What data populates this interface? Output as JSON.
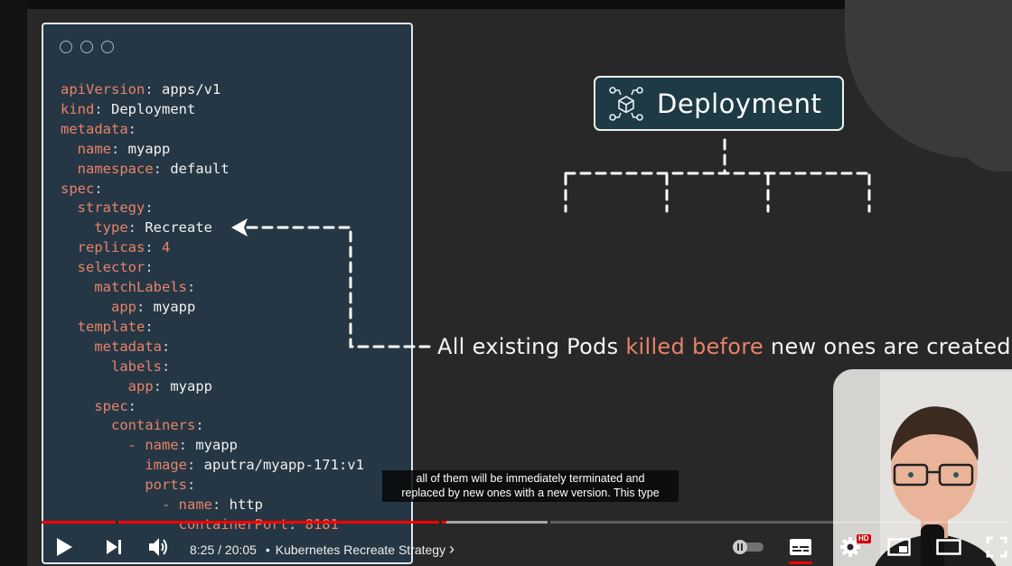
{
  "slide": {
    "code_lines": [
      [
        {
          "t": "apiVersion",
          "c": "k"
        },
        {
          "t": ": ",
          "c": "d"
        },
        {
          "t": "apps/v1",
          "c": "v"
        }
      ],
      [
        {
          "t": "kind",
          "c": "k"
        },
        {
          "t": ": ",
          "c": "d"
        },
        {
          "t": "Deployment",
          "c": "v"
        }
      ],
      [
        {
          "t": "metadata",
          "c": "k"
        },
        {
          "t": ":",
          "c": "d"
        }
      ],
      [
        {
          "t": "  name",
          "c": "k"
        },
        {
          "t": ": ",
          "c": "d"
        },
        {
          "t": "myapp",
          "c": "v"
        }
      ],
      [
        {
          "t": "  namespace",
          "c": "k"
        },
        {
          "t": ": ",
          "c": "d"
        },
        {
          "t": "default",
          "c": "v"
        }
      ],
      [
        {
          "t": "spec",
          "c": "k"
        },
        {
          "t": ":",
          "c": "d"
        }
      ],
      [
        {
          "t": "  strategy",
          "c": "k"
        },
        {
          "t": ":",
          "c": "d"
        }
      ],
      [
        {
          "t": "    type",
          "c": "k"
        },
        {
          "t": ": ",
          "c": "d"
        },
        {
          "t": "Recreate",
          "c": "v"
        }
      ],
      [
        {
          "t": "  replicas",
          "c": "k"
        },
        {
          "t": ": ",
          "c": "d"
        },
        {
          "t": "4",
          "c": "k"
        }
      ],
      [
        {
          "t": "  selector",
          "c": "k"
        },
        {
          "t": ":",
          "c": "d"
        }
      ],
      [
        {
          "t": "    matchLabels",
          "c": "k"
        },
        {
          "t": ":",
          "c": "d"
        }
      ],
      [
        {
          "t": "      app",
          "c": "k"
        },
        {
          "t": ": ",
          "c": "d"
        },
        {
          "t": "myapp",
          "c": "v"
        }
      ],
      [
        {
          "t": "  template",
          "c": "k"
        },
        {
          "t": ":",
          "c": "d"
        }
      ],
      [
        {
          "t": "    metadata",
          "c": "k"
        },
        {
          "t": ":",
          "c": "d"
        }
      ],
      [
        {
          "t": "      labels",
          "c": "k"
        },
        {
          "t": ":",
          "c": "d"
        }
      ],
      [
        {
          "t": "        app",
          "c": "k"
        },
        {
          "t": ": ",
          "c": "d"
        },
        {
          "t": "myapp",
          "c": "v"
        }
      ],
      [
        {
          "t": "    spec",
          "c": "k"
        },
        {
          "t": ":",
          "c": "d"
        }
      ],
      [
        {
          "t": "      containers",
          "c": "k"
        },
        {
          "t": ":",
          "c": "d"
        }
      ],
      [
        {
          "t": "        - ",
          "c": "k"
        },
        {
          "t": "name",
          "c": "k"
        },
        {
          "t": ": ",
          "c": "d"
        },
        {
          "t": "myapp",
          "c": "v"
        }
      ],
      [
        {
          "t": "          image",
          "c": "k"
        },
        {
          "t": ": ",
          "c": "d"
        },
        {
          "t": "aputra/myapp-171:v1",
          "c": "v"
        }
      ],
      [
        {
          "t": "          ports",
          "c": "k"
        },
        {
          "t": ":",
          "c": "d"
        }
      ],
      [
        {
          "t": "            - ",
          "c": "k"
        },
        {
          "t": "name",
          "c": "k"
        },
        {
          "t": ": ",
          "c": "d"
        },
        {
          "t": "http",
          "c": "v"
        }
      ],
      [
        {
          "t": "              containerPort",
          "c": "k"
        },
        {
          "t": ": ",
          "c": "d"
        },
        {
          "t": "8181",
          "c": "k"
        }
      ]
    ],
    "deployment_label": "Deployment",
    "caption_before": "All existing Pods ",
    "caption_highlight": "killed before",
    "caption_after": " new ones are created",
    "colors": {
      "key": "#e8826a",
      "value": "#f1f1f1",
      "panel": "#253744"
    }
  },
  "subtitles": {
    "line1": "all of them will be immediately terminated and",
    "line2": "replaced by new ones with a new version. This type"
  },
  "player": {
    "current_time": "8:25",
    "duration": "20:05",
    "time_separator": "/",
    "bullet": "•",
    "chapter_title": "Kubernetes Recreate Strategy",
    "chapter_chevron": "›",
    "hd_badge": "HD",
    "progress_played_fraction": 0.419,
    "progress_buffered_fraction": 0.523,
    "chapter_marks_fraction": [
      0.077,
      0.411,
      0.523
    ],
    "accent_color": "#ff0000",
    "icons": [
      "play-icon",
      "next-icon",
      "volume-icon",
      "autoplay-toggle-icon",
      "subtitles-icon",
      "settings-icon",
      "miniplayer-icon",
      "theater-icon",
      "fullscreen-icon"
    ]
  }
}
